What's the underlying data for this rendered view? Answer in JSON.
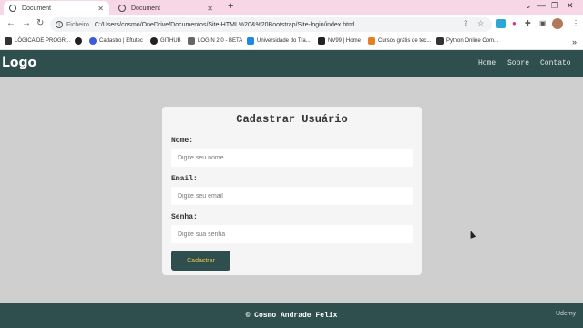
{
  "browser": {
    "tabs": [
      {
        "title": "Document",
        "active": true
      },
      {
        "title": "Document",
        "active": false
      }
    ],
    "address": {
      "scheme": "Ficheiro",
      "path": "C:/Users/cosmo/OneDrive/Documentos/Site-HTML%20&%20Bootstrap/Site-login/index.html"
    },
    "bookmarks": [
      {
        "label": "LÓGICA DE PROGR...",
        "color": "#333333"
      },
      {
        "label": "Cadastro | Eftutec",
        "color": "#3b5bdb"
      },
      {
        "label": "GITHUB",
        "color": "#222222"
      },
      {
        "label": "LOGIN 2.0 - BETA",
        "color": "#666666"
      },
      {
        "label": "Universidade do Tra...",
        "color": "#1e88e5"
      },
      {
        "label": "NV99 | Home",
        "color": "#222222"
      },
      {
        "label": "Cursos grátis de tec...",
        "color": "#e67e22"
      },
      {
        "label": "Python Online Com...",
        "color": "#333333"
      }
    ]
  },
  "site": {
    "logo": "Logo",
    "nav": [
      "Home",
      "Sobre",
      "Contato"
    ],
    "form": {
      "title": "Cadastrar Usuário",
      "fields": [
        {
          "label": "Nome:",
          "placeholder": "Digite seu nome"
        },
        {
          "label": "Email:",
          "placeholder": "Digite seu email"
        },
        {
          "label": "Senha:",
          "placeholder": "Digite sua senha"
        }
      ],
      "submit": "Cadastrar"
    },
    "footer": "© Cosmo Andrade Felix"
  },
  "watermark": "Udemy",
  "colors": {
    "primary": "#2f4f4f",
    "button_text": "#e8c14a",
    "page_bg": "#cfcfcf",
    "tabstrip_bg": "#f7d6e6"
  }
}
